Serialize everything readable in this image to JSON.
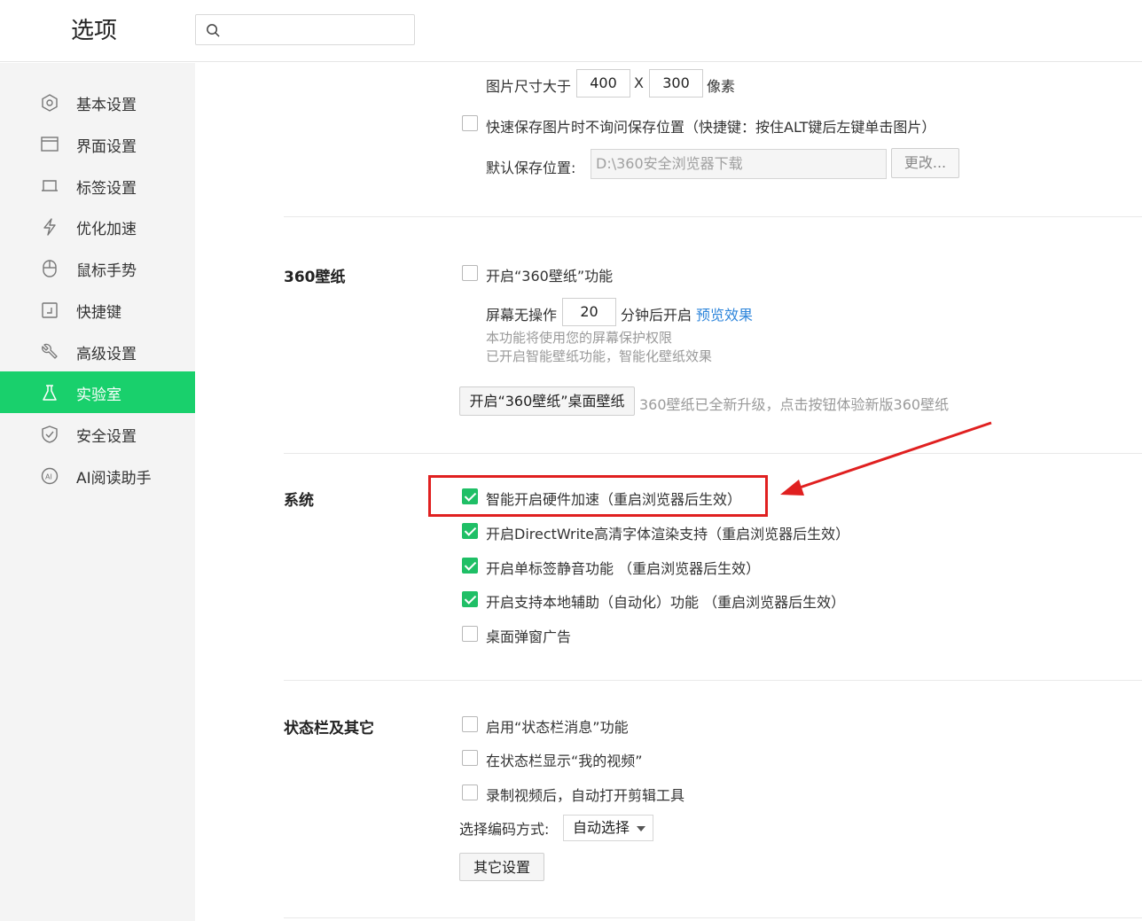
{
  "header": {
    "title": "选项",
    "search_placeholder": ""
  },
  "sidebar": {
    "items": [
      {
        "label": "基本设置",
        "icon": "hexagon-settings-icon"
      },
      {
        "label": "界面设置",
        "icon": "window-icon"
      },
      {
        "label": "标签设置",
        "icon": "tab-icon"
      },
      {
        "label": "优化加速",
        "icon": "lightning-icon"
      },
      {
        "label": "鼠标手势",
        "icon": "mouse-icon"
      },
      {
        "label": "快捷键",
        "icon": "keyboard-shortcut-icon"
      },
      {
        "label": "高级设置",
        "icon": "wrench-icon"
      },
      {
        "label": "实验室",
        "icon": "flask-icon",
        "active": true
      },
      {
        "label": "安全设置",
        "icon": "shield-icon"
      },
      {
        "label": "AI阅读助手",
        "icon": "ai-icon"
      }
    ]
  },
  "image_save": {
    "size_label": "图片尺寸大于",
    "width_value": "400",
    "x_label": "X",
    "height_value": "300",
    "unit_label": "像素",
    "quick_save_label": "快速保存图片时不询问保存位置（快捷键：按住ALT键后左键单击图片）",
    "quick_save_checked": false,
    "default_path_label": "默认保存位置:",
    "default_path_value": "D:\\360安全浏览器下载",
    "change_button": "更改..."
  },
  "wallpaper": {
    "title": "360壁纸",
    "enable_label": "开启“360壁纸”功能",
    "enable_checked": false,
    "idle_prefix": "屏幕无操作",
    "idle_minutes": "20",
    "idle_suffix": "分钟后开启",
    "preview_link": "预览效果",
    "note1": "本功能将使用您的屏幕保护权限",
    "note2": "已开启智能壁纸功能，智能化壁纸效果",
    "desktop_button": "开启“360壁纸”桌面壁纸",
    "upgrade_note": "360壁纸已全新升级，点击按钮体验新版360壁纸"
  },
  "system": {
    "title": "系统",
    "options": [
      {
        "label": "智能开启硬件加速（重启浏览器后生效）",
        "checked": true
      },
      {
        "label": "开启DirectWrite高清字体渲染支持（重启浏览器后生效）",
        "checked": true
      },
      {
        "label": "开启单标签静音功能 （重启浏览器后生效）",
        "checked": true
      },
      {
        "label": "开启支持本地辅助（自动化）功能 （重启浏览器后生效）",
        "checked": true
      },
      {
        "label": "桌面弹窗广告",
        "checked": false
      }
    ]
  },
  "statusbar": {
    "title": "状态栏及其它",
    "options": [
      {
        "label": "启用“状态栏消息”功能",
        "checked": false
      },
      {
        "label": "在状态栏显示“我的视频”",
        "checked": false
      },
      {
        "label": "录制视频后，自动打开剪辑工具",
        "checked": false
      }
    ],
    "encoding_label": "选择编码方式:",
    "encoding_value": "自动选择",
    "other_button": "其它设置"
  },
  "colors": {
    "accent": "#19d06c",
    "checkbox": "#1fbf66",
    "highlight": "#e02020",
    "link": "#2f86db"
  }
}
